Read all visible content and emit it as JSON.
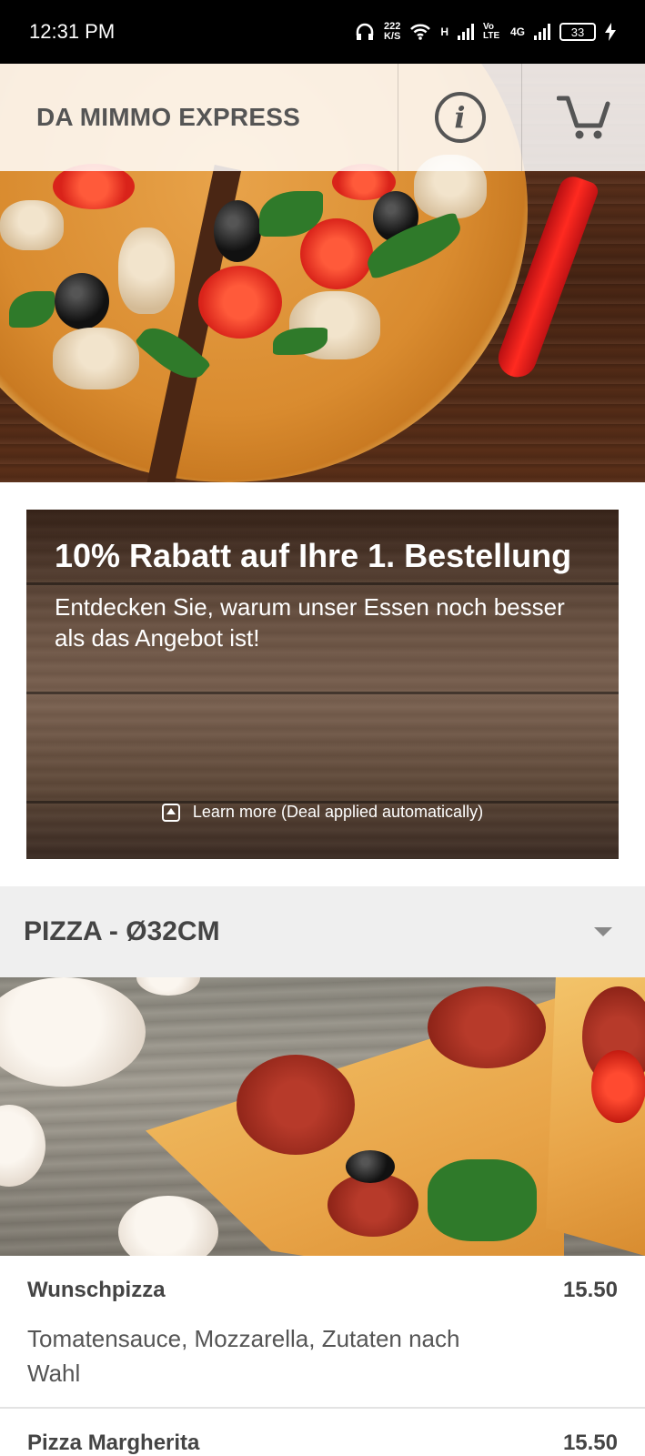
{
  "status_bar": {
    "time": "12:31 PM",
    "speed_value": "222",
    "speed_unit": "K/S",
    "network_h": "H",
    "volte": "Vo LTE",
    "network_4g": "4G",
    "battery": "33"
  },
  "header": {
    "brand": "DA MIMMO EXPRESS",
    "info_icon": "info-icon",
    "cart_icon": "cart-icon"
  },
  "promo": {
    "title": "10% Rabatt auf Ihre 1. Bestellung",
    "subtitle": "Entdecken Sie, warum unser Essen noch besser als das Angebot ist!",
    "link": "Learn more (Deal applied automatically)"
  },
  "category": {
    "title": "PIZZA - Ø32CM"
  },
  "items": [
    {
      "name": "Wunschpizza",
      "price": "15.50",
      "description": "Tomatensauce, Mozzarella, Zutaten nach Wahl"
    },
    {
      "name": "Pizza Margherita",
      "price": "15.50"
    }
  ]
}
